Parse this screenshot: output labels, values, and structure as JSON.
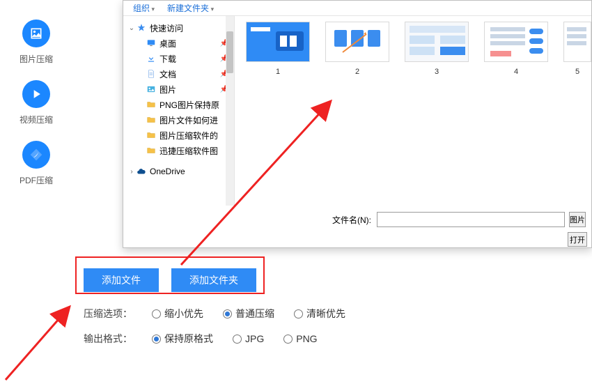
{
  "sidebar": {
    "items": [
      {
        "label": "图片压缩",
        "icon": "image-icon"
      },
      {
        "label": "视频压缩",
        "icon": "play-icon"
      },
      {
        "label": "PDF压缩",
        "icon": "pdf-icon"
      }
    ]
  },
  "dialog": {
    "toolbar": {
      "organize": "组织",
      "new_folder": "新建文件夹"
    },
    "tree": {
      "quick_access": "快速访问",
      "desktop": "桌面",
      "downloads": "下载",
      "documents": "文档",
      "pictures": "图片",
      "folder_a": "PNG图片保持原",
      "folder_b": "图片文件如何进",
      "folder_c": "图片压缩软件的",
      "folder_d": "迅捷压缩软件图",
      "onedrive": "OneDrive"
    },
    "thumbs": [
      "1",
      "2",
      "3",
      "4",
      "5"
    ],
    "filename_label": "文件名(N):",
    "type_button": "图片",
    "open_button": "打开"
  },
  "buttons": {
    "add_file": "添加文件",
    "add_folder": "添加文件夹"
  },
  "options": {
    "compress_label": "压缩选项：",
    "compress": {
      "shrink": "缩小优先",
      "normal": "普通压缩",
      "clear": "清晰优先"
    },
    "format_label": "输出格式：",
    "format": {
      "keep": "保持原格式",
      "jpg": "JPG",
      "png": "PNG"
    }
  }
}
